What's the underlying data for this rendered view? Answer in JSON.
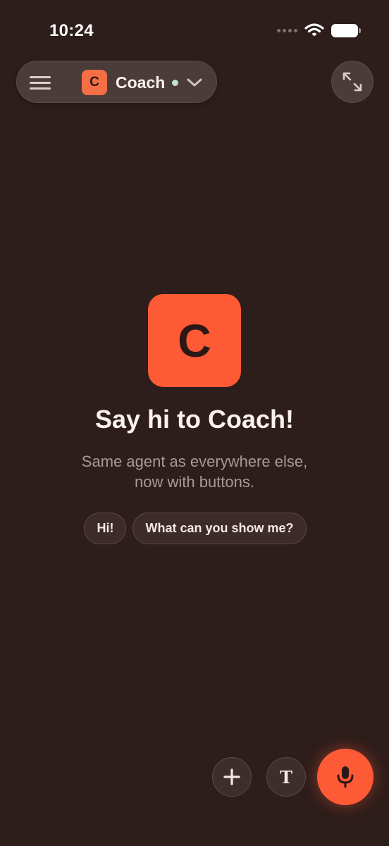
{
  "status_bar": {
    "time": "10:24",
    "icons": [
      "signal-dots-icon",
      "wifi-icon",
      "battery-icon"
    ]
  },
  "header": {
    "menu_icon": "hamburger-menu-icon",
    "agent": {
      "badge_letter": "C",
      "name": "Coach",
      "status": "online",
      "dropdown_icon": "chevron-down-icon"
    },
    "expand_icon": "expand-arrows-icon"
  },
  "hero": {
    "logo_letter": "C",
    "title": "Say hi to Coach!",
    "subtitle_line1": "Same agent as everywhere else,",
    "subtitle_line2": "now with buttons."
  },
  "suggestions": [
    {
      "label": "Hi!"
    },
    {
      "label": "What can you show me?"
    }
  ],
  "controls": {
    "add_icon": "plus-icon",
    "text_mode_label": "T",
    "mic_icon": "microphone-icon"
  },
  "colors": {
    "background": "#2d1d1b",
    "accent": "#fe5a35",
    "online": "#bfe4c6"
  }
}
